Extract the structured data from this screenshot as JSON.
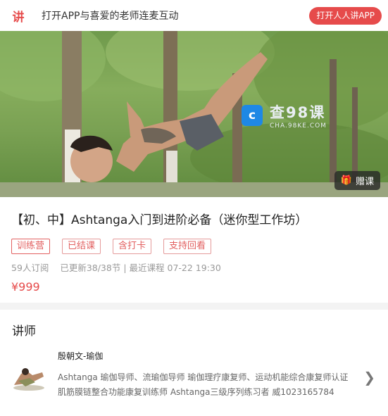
{
  "banner": {
    "logo_char": "讲",
    "text": "打开APP与喜爱的老师连麦互动",
    "open_button": "打开人人讲APP"
  },
  "hero": {
    "watermark_main": "查98课",
    "watermark_sub": "CHA.98KE.COM",
    "watermark_icon": "c",
    "gift_label": "赠课"
  },
  "course": {
    "title": "【初、中】Ashtanga入门到进阶必备（迷你型工作坊）",
    "tags": [
      "训练营",
      "已结课",
      "含打卡",
      "支持回看"
    ],
    "subscribers": "59人订阅",
    "updated": "已更新38/38节",
    "separator": "|",
    "latest": "最近课程 07-22 19:30",
    "price": "¥999"
  },
  "teacher": {
    "heading": "讲师",
    "name": "殷朝文-瑜伽",
    "description": "Ashtanga 瑜伽导师、流瑜伽导师 瑜伽理疗康复师、运动机能综合康复师认证 肌筋膜链整合功能康复训练师 Ashtanga三级序列练习者 威1023165784"
  },
  "colors": {
    "accent": "#e64b4b",
    "tag_border": "#e59a9a",
    "muted": "#999999"
  }
}
